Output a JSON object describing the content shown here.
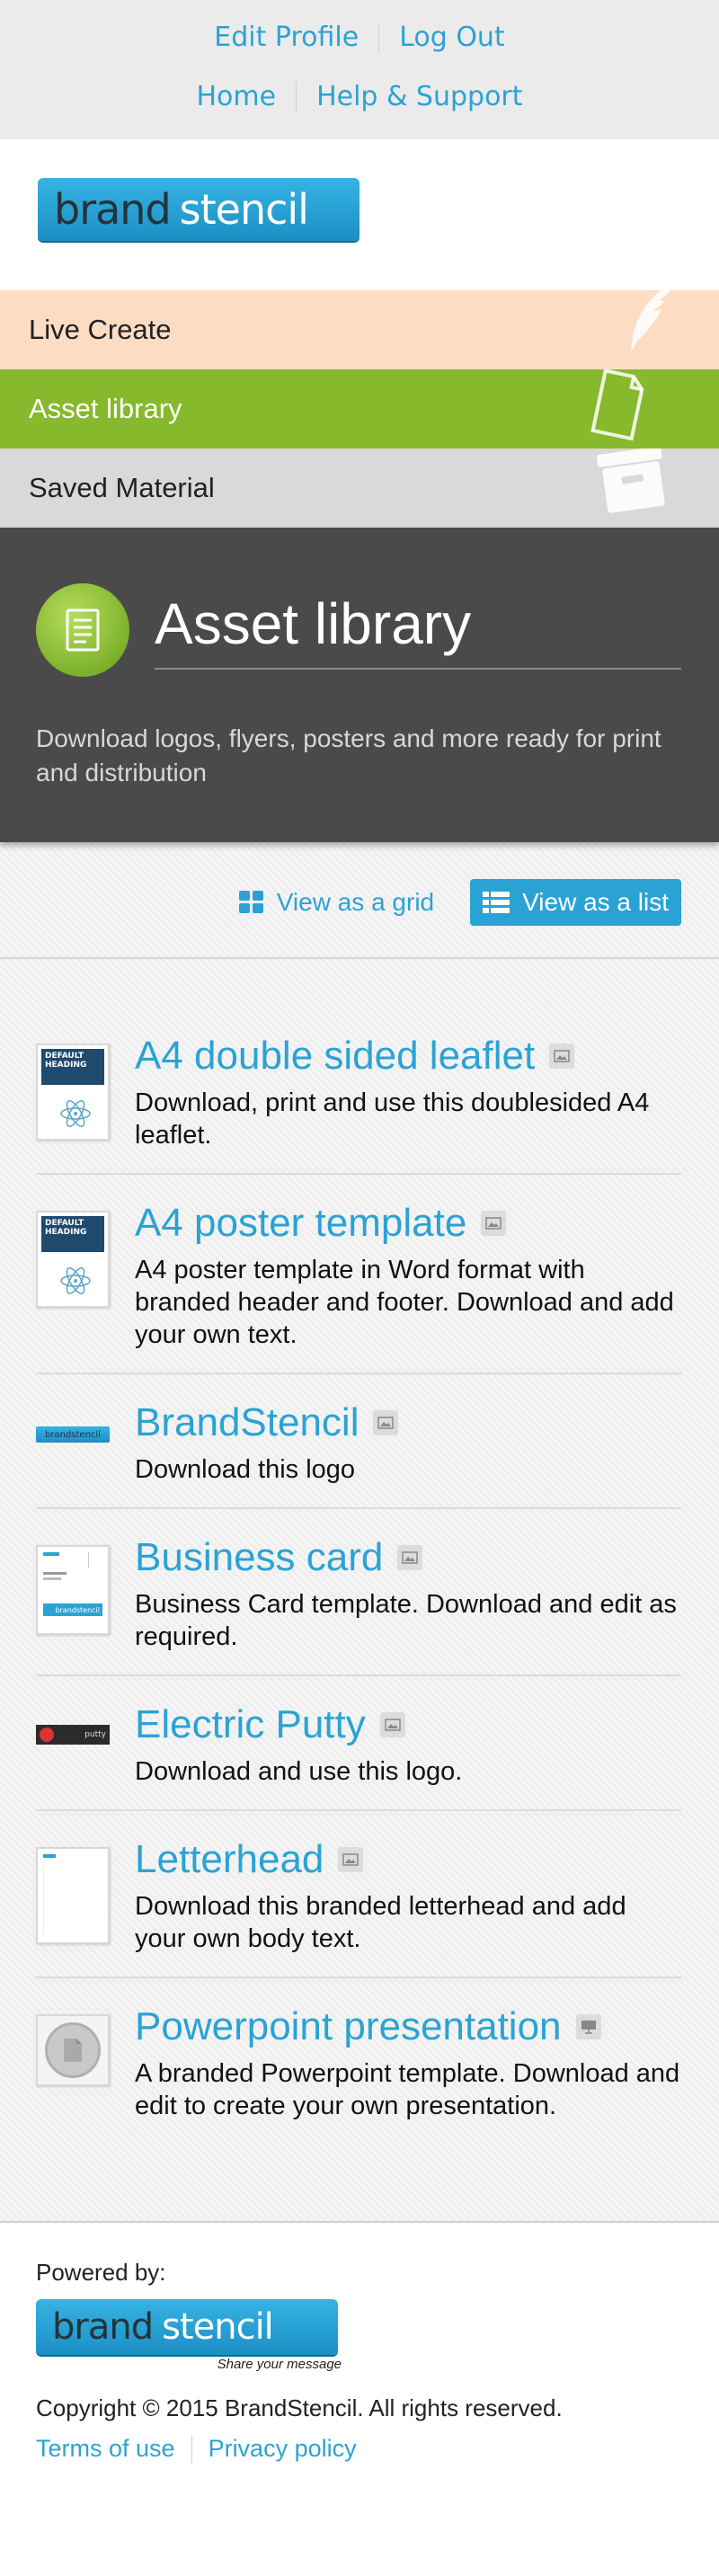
{
  "top_links": {
    "edit_profile": "Edit Profile",
    "log_out": "Log Out",
    "home": "Home",
    "help_support": "Help & Support"
  },
  "logo": {
    "word1": "brand",
    "word2": "stencil"
  },
  "nav": {
    "live_create": "Live Create",
    "asset_library": "Asset library",
    "saved_material": "Saved Material"
  },
  "hero": {
    "title": "Asset library",
    "description": "Download logos, flyers, posters and more ready for print and distribution"
  },
  "view": {
    "grid_label": "View as a grid",
    "list_label": "View as a list"
  },
  "assets": [
    {
      "title": "A4 double sided leaflet",
      "description": "Download, print and use this doublesided A4 leaflet.",
      "thumb_text": "DEFAULT HEADING",
      "type_icon": "image-icon"
    },
    {
      "title": "A4 poster template",
      "description": "A4 poster template in Word format with branded header and footer. Download and add your own text.",
      "thumb_text": "DEFAULT HEADING",
      "type_icon": "image-icon"
    },
    {
      "title": "BrandStencil",
      "description": "Download this logo",
      "thumb_text": "brandstencil",
      "type_icon": "image-icon"
    },
    {
      "title": "Business card",
      "description": "Business Card template. Download and edit as required.",
      "thumb_text": "brandstencil",
      "type_icon": "image-icon"
    },
    {
      "title": "Electric Putty",
      "description": "Download and use this logo.",
      "thumb_text": "putty",
      "type_icon": "image-icon"
    },
    {
      "title": "Letterhead",
      "description": "Download this branded letterhead and add your own body text.",
      "thumb_text": "",
      "type_icon": "image-icon"
    },
    {
      "title": "Powerpoint presentation",
      "description": "A branded Powerpoint template. Download and edit to create your own presentation.",
      "thumb_text": "",
      "type_icon": "presentation-icon"
    }
  ],
  "footer": {
    "powered_by": "Powered by:",
    "tagline": "Share your message",
    "copyright": "Copyright © 2015 BrandStencil. All rights reserved.",
    "terms": "Terms of use",
    "privacy": "Privacy policy"
  },
  "colors": {
    "accent": "#2aa3d4",
    "live_create_bg": "#fddcc4",
    "asset_library_bg": "#86b92b",
    "saved_material_bg": "#d9d9d9",
    "hero_bg": "#4a4a4a"
  }
}
